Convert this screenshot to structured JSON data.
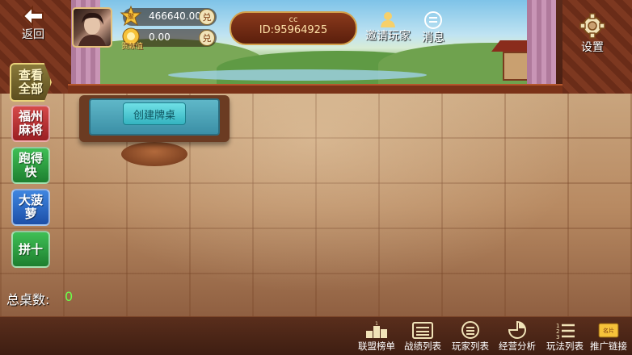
{
  "header": {
    "back_label": "返回",
    "gold": {
      "icon": "gold-ingot-icon",
      "badge": "聚",
      "value": "466640.00",
      "exchange": "兑"
    },
    "contribution": {
      "icon": "contribution-medal-icon",
      "caption": "贡献值",
      "value": "0.00",
      "exchange": "兑"
    },
    "player_name": "cc",
    "player_id": "ID:95964925",
    "invite_label": "邀请玩家",
    "message_label": "消息",
    "settings_label": "设置"
  },
  "categories": [
    {
      "label": "查看全部",
      "line1": "查看",
      "line2": "全部"
    },
    {
      "label": "福州麻将",
      "line1": "福州",
      "line2": "麻将"
    },
    {
      "label": "跑得快",
      "line1": "跑得",
      "line2": "快"
    },
    {
      "label": "大菠萝",
      "line1": "大菠",
      "line2": "萝"
    },
    {
      "label": "拼十",
      "line1": "拼十",
      "line2": ""
    }
  ],
  "table": {
    "create_label": "创建牌桌"
  },
  "stats": {
    "total_label": "总桌数:",
    "total_value": "0"
  },
  "bottom_nav": [
    {
      "label": "联盟榜单",
      "icon": "podium-icon"
    },
    {
      "label": "战绩列表",
      "icon": "record-list-icon"
    },
    {
      "label": "玩家列表",
      "icon": "player-list-icon"
    },
    {
      "label": "经营分析",
      "icon": "analysis-icon"
    },
    {
      "label": "玩法列表",
      "icon": "rules-list-icon"
    },
    {
      "label": "推广链接",
      "icon": "promo-card-icon",
      "badge": "名片"
    }
  ],
  "colors": {
    "accent_gold": "#e4c07a",
    "total_value": "#6bff4a",
    "felt": "#3b8fa6"
  }
}
